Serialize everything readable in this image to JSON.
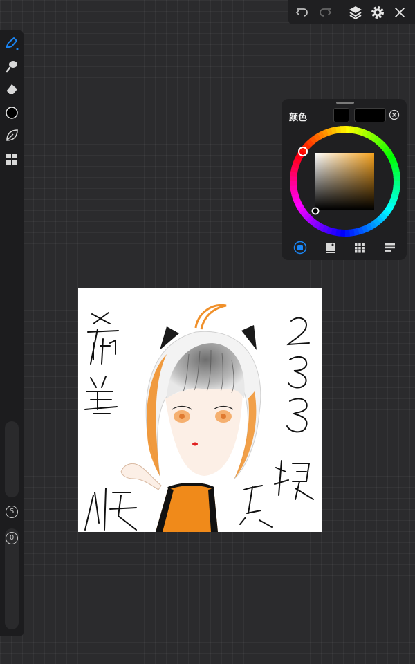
{
  "color_panel": {
    "title": "颜色",
    "primary_color": "#000000",
    "secondary_color": "#000000",
    "tabs": [
      "disc",
      "classic",
      "palettes",
      "value"
    ],
    "active_tab": "disc",
    "hue_color": "#f7a31e"
  },
  "side_toolbar": {
    "modifier_size_label": "S",
    "modifier_opacity_label": "0",
    "accent_color": "#1a86f6"
  },
  "canvas": {
    "text_left_col": [
      "希",
      "望",
      "快"
    ],
    "text_right_col": [
      "2",
      "3",
      "3",
      "娘"
    ],
    "text_bottom": "乐",
    "hair_accent": "#f0902a"
  }
}
